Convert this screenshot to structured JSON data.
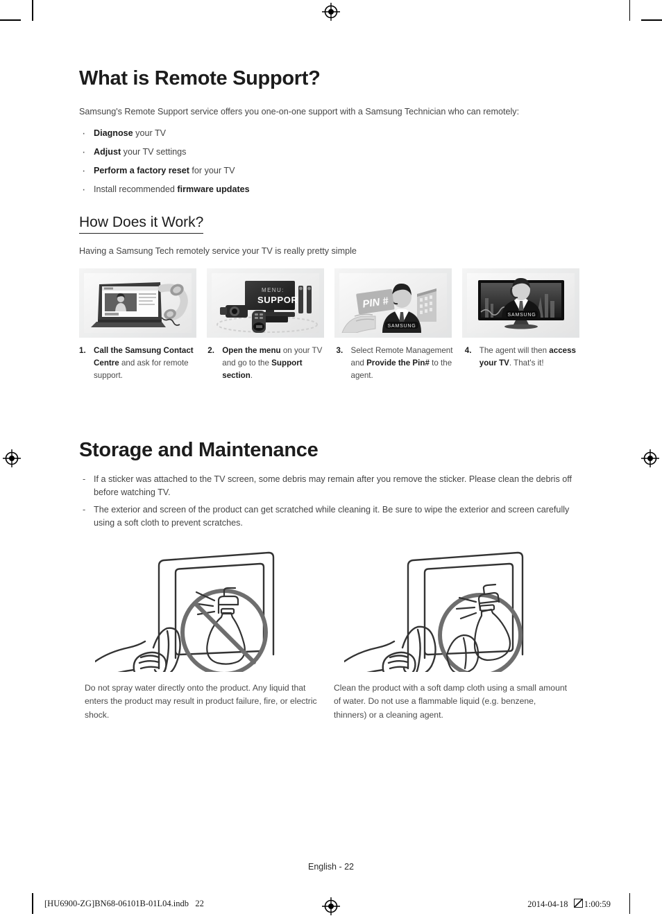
{
  "document": {
    "section1": {
      "title": "What is Remote Support?",
      "intro": "Samsung's Remote Support service offers you one-on-one support with a Samsung Technician who can remotely:",
      "bullets": [
        {
          "bold_lead": "Diagnose",
          "rest": " your TV"
        },
        {
          "bold_lead": "Adjust",
          "rest": " your TV settings"
        },
        {
          "bold_lead": "Perform a factory reset",
          "rest": " for your TV"
        },
        {
          "plain_lead": "Install recommended ",
          "bold_tail": "firmware updates"
        }
      ]
    },
    "section2": {
      "title": "How Does it Work?",
      "intro": "Having a Samsung Tech remotely service your TV is really pretty simple",
      "panels": [
        {
          "icon": "laptop-phone-support-image",
          "caption_alt": "Laptop with telephone handset"
        },
        {
          "icon": "tv-menu-support-image",
          "screen_line1": "MENU:",
          "screen_line2": "SUPPORT"
        },
        {
          "icon": "pin-card-agent-image",
          "card_label": "PIN #",
          "brand": "SAMSUNG"
        },
        {
          "icon": "tv-agent-image",
          "brand": "SAMSUNG"
        }
      ],
      "steps": [
        {
          "num": "1.",
          "part1_bold": "Call the Samsung Contact Centre",
          "part2": " and ask for remote support."
        },
        {
          "num": "2.",
          "part1_bold": "Open the menu",
          "part2": " on your TV and go to the ",
          "part3_bold": "Support section",
          "part4": "."
        },
        {
          "num": "3.",
          "part1": "Select Remote Management and ",
          "part2_bold": "Provide the Pin#",
          "part3": " to the agent."
        },
        {
          "num": "4.",
          "part1": "The agent will then ",
          "part2_bold": "access your TV",
          "part3": ". That's it!"
        }
      ]
    },
    "section3": {
      "title": "Storage and Maintenance",
      "bullets": [
        "If a sticker was attached to the TV screen, some debris may remain after you remove the sticker. Please clean the debris off before watching TV.",
        "The exterior and screen of the product can get scratched while cleaning it. Be sure to wipe the exterior and screen carefully using a soft cloth to prevent scratches."
      ],
      "illustrations": [
        {
          "icon": "no-spray-on-tv-illustration",
          "caption": "Do not spray water directly onto the product. Any liquid that enters the product may result in product failure, fire, or electric shock."
        },
        {
          "icon": "spray-on-cloth-illustration",
          "caption": "Clean the product with a soft damp cloth using a small amount of water. Do not use a flammable liquid (e.g. benzene, thinners) or a cleaning agent."
        }
      ]
    }
  },
  "footer": {
    "page_label": "English - 22",
    "print_slug": "[HU6900-ZG]BN68-06101B-01L04.indb   22",
    "print_date": "2014-04-18",
    "print_time": "1:00:59"
  },
  "colors": {
    "heading": "#1c1c1c",
    "body_text": "#444444",
    "panel_bg": "#eceded",
    "line_art": "#333333"
  }
}
